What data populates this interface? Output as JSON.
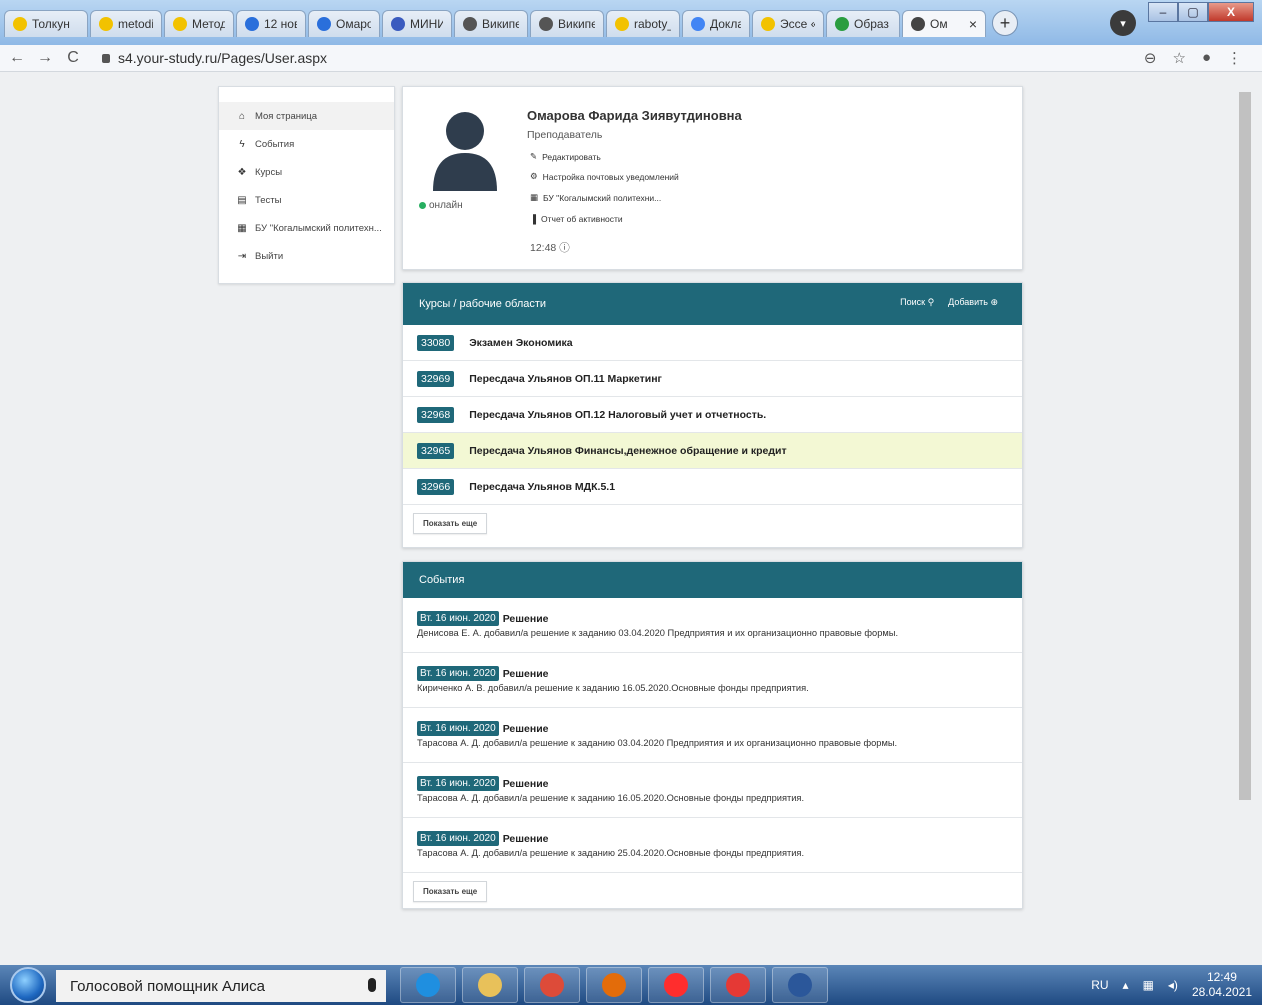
{
  "browser": {
    "tabs": [
      {
        "label": "Толкун",
        "color": "#f2c200"
      },
      {
        "label": "metodi",
        "color": "#f2c200"
      },
      {
        "label": "Метод",
        "color": "#f2c200"
      },
      {
        "label": "12 нов",
        "color": "#2a6fdb"
      },
      {
        "label": "Омаро",
        "color": "#2a6fdb"
      },
      {
        "label": "МИНИ",
        "color": "#3a5bbf"
      },
      {
        "label": "Википе",
        "color": "#555555"
      },
      {
        "label": "Википе",
        "color": "#555555"
      },
      {
        "label": "raboty_",
        "color": "#f2c200"
      },
      {
        "label": "Доклад",
        "color": "#4285f4"
      },
      {
        "label": "Эссе «",
        "color": "#f2c200"
      },
      {
        "label": "Образ",
        "color": "#2a9d3f"
      },
      {
        "label": "Ом",
        "color": "#444444"
      }
    ],
    "active_tab_close": "×",
    "new_tab": "+",
    "url": "s4.your-study.ru/Pages/User.aspx",
    "nav": {
      "back": "←",
      "forward": "→",
      "reload": "C"
    }
  },
  "sidebar": {
    "items": [
      {
        "icon": "home-icon",
        "glyph": "⌂",
        "label": "Моя страница"
      },
      {
        "icon": "bolt-icon",
        "glyph": "ϟ",
        "label": "События"
      },
      {
        "icon": "graduation-icon",
        "glyph": "❖",
        "label": "Курсы"
      },
      {
        "icon": "test-icon",
        "glyph": "▤",
        "label": "Тесты"
      },
      {
        "icon": "building-icon",
        "glyph": "▦",
        "label": "БУ \"Когалымский политехн..."
      },
      {
        "icon": "logout-icon",
        "glyph": "⇥",
        "label": "Выйти"
      }
    ]
  },
  "profile": {
    "name": "Омарова Фарида Зиявутдиновна",
    "role": "Преподаватель",
    "status": "онлайн",
    "links": [
      {
        "icon": "pencil-icon",
        "glyph": "✎",
        "label": "Редактировать"
      },
      {
        "icon": "gear-icon",
        "glyph": "⚙",
        "label": "Настройка почтовых уведомлений"
      },
      {
        "icon": "building-icon",
        "glyph": "▦",
        "label": "БУ \"Когалымский политехни..."
      },
      {
        "icon": "bar-chart-icon",
        "glyph": "▐",
        "label": "Отчет об активности"
      }
    ],
    "time": "12:48"
  },
  "courses": {
    "title": "Курсы / рабочие области",
    "search_label": "Поиск",
    "add_label": "Добавить",
    "rows": [
      {
        "id": "33080",
        "title": "Экзамен Экономика"
      },
      {
        "id": "32969",
        "title": "Пересдача Ульянов ОП.11 Маркетинг"
      },
      {
        "id": "32968",
        "title": "Пересдача Ульянов ОП.12 Налоговый учет и отчетность."
      },
      {
        "id": "32965",
        "title": "Пересдача Ульянов Финансы,денежное обращение и кредит"
      },
      {
        "id": "32966",
        "title": "Пересдача Ульянов МДК.5.1"
      }
    ],
    "more_label": "Показать еще"
  },
  "events": {
    "title": "События",
    "rows": [
      {
        "date": "Вт. 16 июн. 2020",
        "type": "Решение",
        "text": "Денисова Е. А. добавил/а решение к заданию 03.04.2020 Предприятия и их организационно правовые формы."
      },
      {
        "date": "Вт. 16 июн. 2020",
        "type": "Решение",
        "text": "Кириченко А. В. добавил/а решение к заданию 16.05.2020.Основные фонды предприятия."
      },
      {
        "date": "Вт. 16 июн. 2020",
        "type": "Решение",
        "text": "Тарасова А. Д. добавил/а решение к заданию 03.04.2020 Предприятия и их организационно правовые формы."
      },
      {
        "date": "Вт. 16 июн. 2020",
        "type": "Решение",
        "text": "Тарасова А. Д. добавил/а решение к заданию 16.05.2020.Основные фонды предприятия."
      },
      {
        "date": "Вт. 16 июн. 2020",
        "type": "Решение",
        "text": "Тарасова А. Д. добавил/а решение к заданию 25.04.2020.Основные фонды предприятия."
      }
    ],
    "more_label": "Показать еще"
  },
  "taskbar": {
    "search_text": "Голосовой помощник Алиса",
    "lang": "RU",
    "time": "12:49",
    "date": "28.04.2021",
    "apps": [
      {
        "icon": "ie-icon",
        "color": "#1f8fe0"
      },
      {
        "icon": "explorer-icon",
        "color": "#e8c15a"
      },
      {
        "icon": "chrome-icon",
        "color": "#dd4b39"
      },
      {
        "icon": "outlook-icon",
        "color": "#e36c0a"
      },
      {
        "icon": "yandex-icon",
        "color": "#ff2d2d"
      },
      {
        "icon": "yandex-browser-icon",
        "color": "#e53935"
      },
      {
        "icon": "word-icon",
        "color": "#2b579a"
      }
    ]
  }
}
